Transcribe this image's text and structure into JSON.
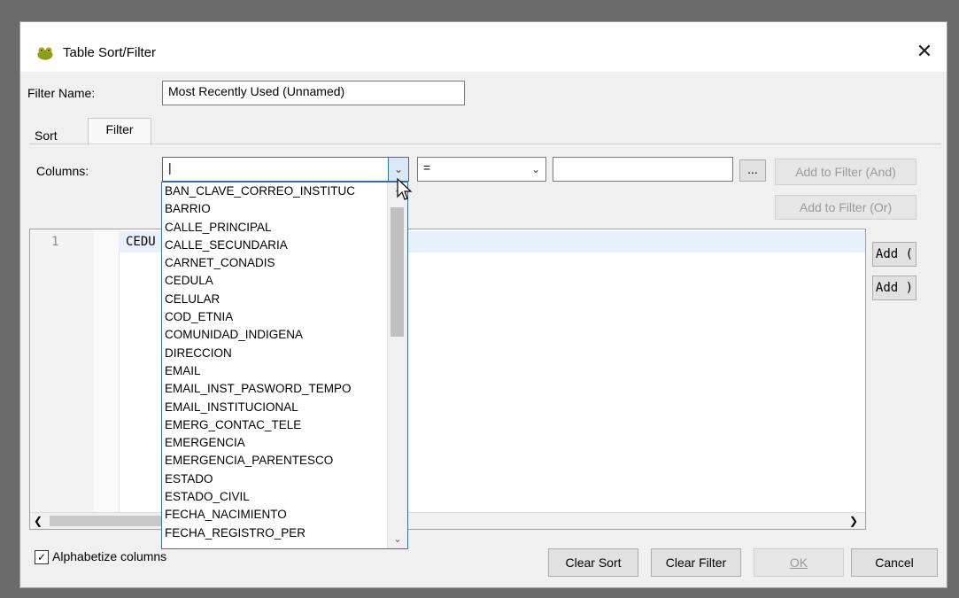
{
  "window": {
    "title": "Table Sort/Filter",
    "close_glyph": "✕"
  },
  "filter_name": {
    "label": "Filter Name:",
    "value": "Most Recently Used (Unnamed)"
  },
  "tabs": [
    {
      "label": "Sort"
    },
    {
      "label": "Filter"
    }
  ],
  "columns": {
    "label": "Columns:",
    "value": "|",
    "operator": "=",
    "value_field": "",
    "browse_label": "...",
    "add_and_label": "Add to Filter (And)",
    "add_or_label": "Add to Filter (Or)",
    "options": [
      "BAN_CLAVE_CORREO_INSTITUC",
      "BARRIO",
      "CALLE_PRINCIPAL",
      "CALLE_SECUNDARIA",
      "CARNET_CONADIS",
      "CEDULA",
      "CELULAR",
      "COD_ETNIA",
      "COMUNIDAD_INDIGENA",
      "DIRECCION",
      "EMAIL",
      "EMAIL_INST_PASWORD_TEMPO",
      "EMAIL_INSTITUCIONAL",
      "EMERG_CONTAC_TELE",
      "EMERGENCIA",
      "EMERGENCIA_PARENTESCO",
      "ESTADO",
      "ESTADO_CIVIL",
      "FECHA_NACIMIENTO",
      "FECHA_REGISTRO_PER"
    ]
  },
  "editor": {
    "line_number": "1",
    "code": "CEDU"
  },
  "side_buttons": {
    "add_open": "Add (",
    "add_close": "Add )"
  },
  "alphabetize": {
    "label": "Alphabetize columns",
    "checked": true,
    "mark": "✓"
  },
  "footer": {
    "clear_sort": "Clear Sort",
    "clear_filter": "Clear Filter",
    "ok": "OK",
    "cancel": "Cancel"
  }
}
